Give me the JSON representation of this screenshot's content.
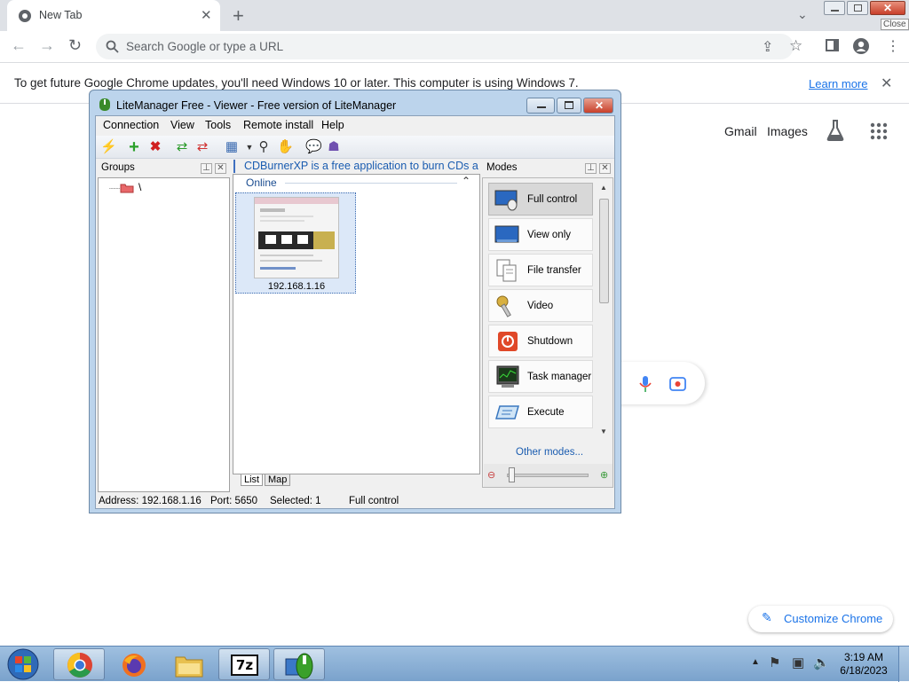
{
  "chrome": {
    "tab_title": "New Tab",
    "omnibox_placeholder": "Search Google or type a URL",
    "infobar_message": "To get future Google Chrome updates, you'll need Windows 10 or later. This computer is using Windows 7.",
    "infobar_link": "Learn more",
    "close_tooltip": "Close",
    "accent": "#1a73e8"
  },
  "ntp": {
    "gmail": "Gmail",
    "images": "Images",
    "customize": "Customize Chrome"
  },
  "litemanager": {
    "title": "LiteManager Free - Viewer - Free version of LiteManager",
    "menu": [
      "Connection",
      "View",
      "Tools",
      "Remote install",
      "Help"
    ],
    "groups_header": "Groups",
    "groups_root": "\\",
    "ticker": "CDBurnerXP is a free application to burn CDs a",
    "online_header": "Online",
    "computer_ip": "192.168.1.16",
    "tabs": [
      "List",
      "Map"
    ],
    "modes_header": "Modes",
    "modes": [
      "Full control",
      "View only",
      "File transfer",
      "Video",
      "Shutdown",
      "Task manager",
      "Execute"
    ],
    "other_modes": "Other modes...",
    "status": {
      "address": "Address: 192.168.1.16",
      "port": "Port: 5650",
      "selected": "Selected: 1",
      "mode": "Full control"
    }
  },
  "taskbar": {
    "time": "3:19 AM",
    "date": "6/18/2023"
  }
}
